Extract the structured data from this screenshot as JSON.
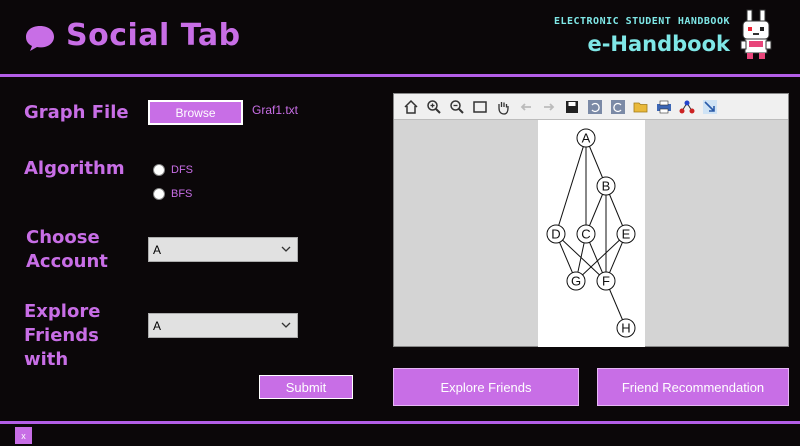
{
  "app": {
    "title": "Social Tab",
    "brand_subtitle": "ELECTRONIC STUDENT HANDBOOK",
    "brand_title": "e-Handbook"
  },
  "form": {
    "graph_file_label": "Graph File",
    "browse_label": "Browse",
    "file_name": "Graf1.txt",
    "algorithm_label": "Algorithm",
    "algorithm_options": [
      "DFS",
      "BFS"
    ],
    "choose_account_label_line1": "Choose",
    "choose_account_label_line2": "Account",
    "choose_account_value": "A",
    "explore_label_line1": "Explore",
    "explore_label_line2": "Friends",
    "explore_label_line3": "with",
    "explore_value": "A",
    "submit_label": "Submit"
  },
  "graph": {
    "toolbar_icons": [
      "home-icon",
      "zoom-in-icon",
      "zoom-out-icon",
      "select-rect-icon",
      "pan-hand-icon",
      "back-arrow-icon",
      "forward-arrow-icon",
      "save-icon",
      "undo-icon",
      "redo-icon",
      "open-folder-icon",
      "print-icon",
      "layout-icon",
      "fit-icon"
    ],
    "nodes": [
      "A",
      "B",
      "C",
      "D",
      "E",
      "F",
      "G",
      "H"
    ],
    "edges": [
      [
        "A",
        "B"
      ],
      [
        "A",
        "C"
      ],
      [
        "A",
        "D"
      ],
      [
        "B",
        "C"
      ],
      [
        "B",
        "E"
      ],
      [
        "B",
        "F"
      ],
      [
        "C",
        "G"
      ],
      [
        "C",
        "F"
      ],
      [
        "D",
        "G"
      ],
      [
        "D",
        "F"
      ],
      [
        "E",
        "F"
      ],
      [
        "E",
        "G"
      ],
      [
        "F",
        "H"
      ]
    ]
  },
  "actions": {
    "explore_label": "Explore Friends",
    "recommend_label": "Friend Recommendation"
  },
  "footer": {
    "close_label": "x"
  },
  "colors": {
    "accent": "#c86ee6",
    "background": "#0b0709",
    "brand_text": "#7fe7e7"
  }
}
